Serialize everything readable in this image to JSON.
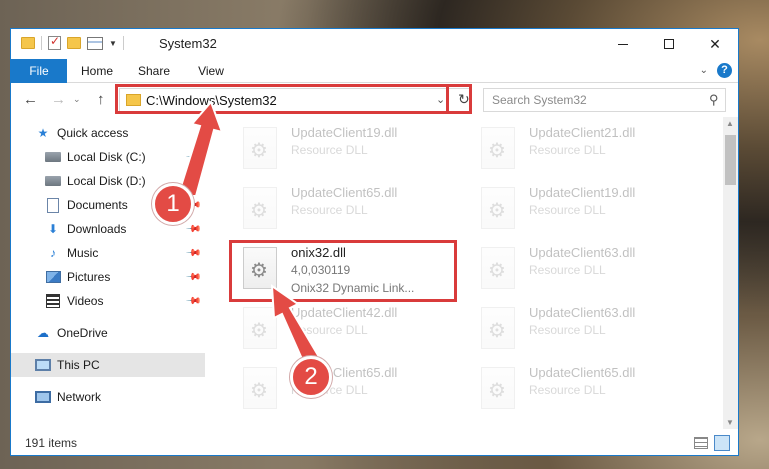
{
  "window": {
    "title": "System32",
    "controls": {
      "minimize": "",
      "maximize": "",
      "close": "✕"
    }
  },
  "ribbon": {
    "tabs": [
      "File",
      "Home",
      "Share",
      "View"
    ],
    "help": "?"
  },
  "address": {
    "path": "C:\\Windows\\System32"
  },
  "search": {
    "placeholder": "Search System32"
  },
  "nav": {
    "items": [
      {
        "label": "Quick access",
        "icon": "star-icon"
      },
      {
        "label": "Local Disk (C:)",
        "icon": "disk-icon",
        "pinned": true
      },
      {
        "label": "Local Disk (D:)",
        "icon": "disk-icon",
        "pinned": true
      },
      {
        "label": "Documents",
        "icon": "documents-icon",
        "pinned": true
      },
      {
        "label": "Downloads",
        "icon": "download-icon",
        "pinned": true
      },
      {
        "label": "Music",
        "icon": "music-icon",
        "pinned": true
      },
      {
        "label": "Pictures",
        "icon": "pictures-icon",
        "pinned": true
      },
      {
        "label": "Videos",
        "icon": "videos-icon",
        "pinned": true
      },
      {
        "label": "OneDrive",
        "icon": "cloud-icon"
      },
      {
        "label": "This PC",
        "icon": "computer-icon",
        "selected": true
      },
      {
        "label": "Network",
        "icon": "network-icon"
      }
    ]
  },
  "files": [
    {
      "name": "UpdateClient19.dll",
      "type": "Resource DLL",
      "faded": true
    },
    {
      "name": "UpdateClient21.dll",
      "type": "Resource DLL",
      "faded": true
    },
    {
      "name": "UpdateClient65.dll",
      "type": "Resource DLL",
      "faded": true
    },
    {
      "name": "UpdateClient19.dll",
      "type": "Resource DLL",
      "faded": true
    },
    {
      "name": "onix32.dll",
      "type": "4,0,030119",
      "desc": "Onix32 Dynamic Link...",
      "faded": false
    },
    {
      "name": "UpdateClient63.dll",
      "type": "Resource DLL",
      "faded": true
    },
    {
      "name": "UpdateClient42.dll",
      "type": "Resource DLL",
      "faded": true
    },
    {
      "name": "UpdateClient63.dll",
      "type": "Resource DLL",
      "faded": true
    },
    {
      "name": "UpdateClient65.dll",
      "type": "Resource DLL",
      "faded": true
    },
    {
      "name": "UpdateClient65.dll",
      "type": "Resource DLL",
      "faded": true
    }
  ],
  "status": {
    "count": "191 items"
  },
  "callouts": {
    "one": "1",
    "two": "2"
  },
  "colors": {
    "accent": "#1979ca",
    "highlight": "#d93b3b",
    "badge": "#e34b45"
  }
}
